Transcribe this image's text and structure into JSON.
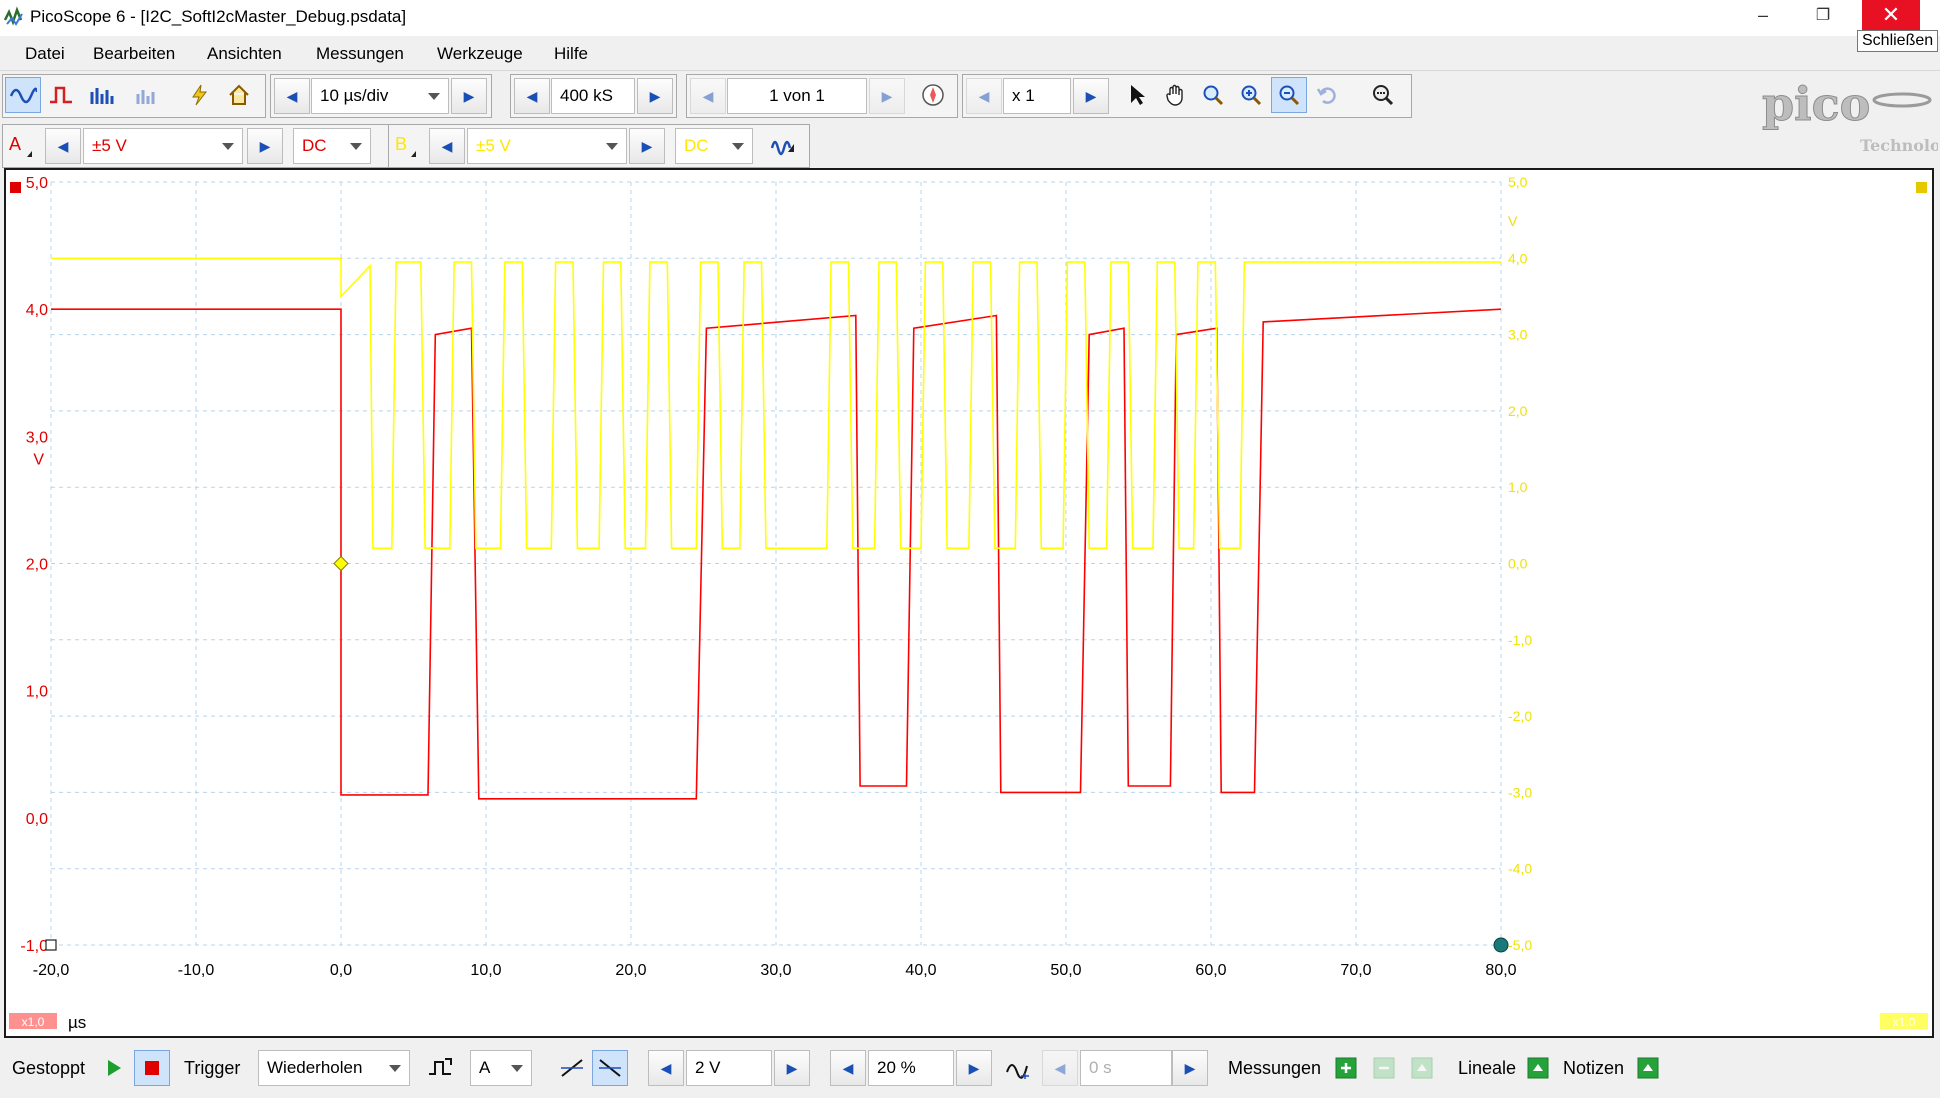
{
  "window": {
    "title": "PicoScope 6 - [I2C_SoftI2cMaster_Debug.psdata]",
    "minimize_icon": "minimize-icon",
    "restore_icon": "restore-icon",
    "close_icon": "close-icon",
    "close_tooltip": "Schließen"
  },
  "menu": [
    "Datei",
    "Bearbeiten",
    "Ansichten",
    "Messungen",
    "Werkzeuge",
    "Hilfe"
  ],
  "toolbar": {
    "timebase": "10 µs/div",
    "samples": "400 kS",
    "buffer": "1 von 1",
    "zoom": "x 1",
    "icons": [
      "scope-mode-icon",
      "persistence-mode-icon",
      "spectrum-mode-icon",
      "spectrum-alt-icon",
      "auto-setup-icon",
      "home-icon",
      "navigate-icon",
      "pointer-icon",
      "hand-icon",
      "zoom-icon",
      "zoom-in-icon",
      "zoom-out-icon",
      "undo-zoom-icon",
      "zoom-overview-icon"
    ]
  },
  "channels": {
    "a": {
      "label": "A",
      "range": "±5 V",
      "coupling": "DC",
      "color": "#ff0000"
    },
    "b": {
      "label": "B",
      "range": "±5 V",
      "coupling": "DC",
      "color": "#ffff00"
    }
  },
  "logo": {
    "brand": "pico",
    "sub": "Technology"
  },
  "chart_data": {
    "type": "line",
    "xlabel": "µs",
    "xlim": [
      -20,
      80
    ],
    "x_ticks": [
      "-20,0",
      "-10,0",
      "0,0",
      "10,0",
      "20,0",
      "30,0",
      "40,0",
      "50,0",
      "60,0",
      "70,0",
      "80,0"
    ],
    "left_axis": {
      "unit": "V",
      "ylim": [
        -1,
        5
      ],
      "ticks": [
        "5,0",
        "4,0",
        "3,0",
        "2,0",
        "1,0",
        "0,0",
        "-1,0"
      ]
    },
    "right_axis": {
      "unit": "V",
      "ylim": [
        -5,
        5
      ],
      "ticks": [
        "5,0",
        "4,0",
        "3,0",
        "2,0",
        "1,0",
        "0,0",
        "-1,0",
        "-2,0",
        "-3,0",
        "-4,0",
        "-5,0"
      ]
    },
    "scale_a": "x1,0",
    "scale_b": "x1,0",
    "series": [
      {
        "color": "#ff0000",
        "axis": "left",
        "points": [
          [
            -20,
            4.0
          ],
          [
            0.0,
            4.0
          ],
          [
            0.0,
            0.18
          ],
          [
            6.0,
            0.18
          ],
          [
            6.5,
            3.8
          ],
          [
            9.0,
            3.85
          ],
          [
            9.5,
            0.15
          ],
          [
            24.5,
            0.15
          ],
          [
            25.2,
            3.85
          ],
          [
            35.5,
            3.95
          ],
          [
            35.8,
            0.25
          ],
          [
            39.0,
            0.25
          ],
          [
            39.5,
            3.85
          ],
          [
            45.2,
            3.95
          ],
          [
            45.5,
            0.2
          ],
          [
            51.0,
            0.2
          ],
          [
            51.6,
            3.8
          ],
          [
            54.0,
            3.85
          ],
          [
            54.3,
            0.25
          ],
          [
            57.2,
            0.25
          ],
          [
            57.6,
            3.8
          ],
          [
            60.4,
            3.85
          ],
          [
            60.7,
            0.2
          ],
          [
            63.0,
            0.2
          ],
          [
            63.6,
            3.9
          ],
          [
            80,
            4.0
          ]
        ]
      },
      {
        "color": "#ffff00",
        "axis": "right",
        "points": [
          [
            -20,
            4.0
          ],
          [
            0.0,
            4.0
          ],
          [
            0.0,
            3.5
          ],
          [
            2.0,
            3.9
          ],
          [
            2.2,
            0.2
          ],
          [
            3.5,
            0.2
          ],
          [
            3.8,
            3.95
          ],
          [
            5.5,
            3.95
          ],
          [
            5.8,
            0.2
          ],
          [
            7.5,
            0.2
          ],
          [
            7.8,
            3.95
          ],
          [
            9.0,
            3.95
          ],
          [
            9.3,
            0.2
          ],
          [
            11.0,
            0.2
          ],
          [
            11.3,
            3.95
          ],
          [
            12.5,
            3.95
          ],
          [
            12.8,
            0.2
          ],
          [
            14.5,
            0.2
          ],
          [
            14.8,
            3.95
          ],
          [
            16.0,
            3.95
          ],
          [
            16.3,
            0.2
          ],
          [
            17.8,
            0.2
          ],
          [
            18.1,
            3.95
          ],
          [
            19.3,
            3.95
          ],
          [
            19.6,
            0.2
          ],
          [
            21.0,
            0.2
          ],
          [
            21.3,
            3.95
          ],
          [
            22.5,
            3.95
          ],
          [
            22.8,
            0.2
          ],
          [
            24.5,
            0.2
          ],
          [
            24.8,
            3.95
          ],
          [
            26.0,
            3.95
          ],
          [
            26.3,
            0.2
          ],
          [
            27.5,
            0.2
          ],
          [
            27.8,
            3.95
          ],
          [
            29.0,
            3.95
          ],
          [
            29.3,
            0.2
          ],
          [
            33.5,
            0.2
          ],
          [
            33.8,
            3.95
          ],
          [
            35.0,
            3.95
          ],
          [
            35.3,
            0.2
          ],
          [
            36.8,
            0.2
          ],
          [
            37.1,
            3.95
          ],
          [
            38.3,
            3.95
          ],
          [
            38.6,
            0.2
          ],
          [
            40.0,
            0.2
          ],
          [
            40.3,
            3.95
          ],
          [
            41.5,
            3.95
          ],
          [
            41.8,
            0.2
          ],
          [
            43.3,
            0.2
          ],
          [
            43.6,
            3.95
          ],
          [
            44.8,
            3.95
          ],
          [
            45.1,
            0.2
          ],
          [
            46.5,
            0.2
          ],
          [
            46.8,
            3.95
          ],
          [
            48.0,
            3.95
          ],
          [
            48.3,
            0.2
          ],
          [
            49.8,
            0.2
          ],
          [
            50.1,
            3.95
          ],
          [
            51.3,
            3.95
          ],
          [
            51.6,
            0.2
          ],
          [
            52.8,
            0.2
          ],
          [
            53.1,
            3.95
          ],
          [
            54.3,
            3.95
          ],
          [
            54.6,
            0.2
          ],
          [
            56.0,
            0.2
          ],
          [
            56.3,
            3.95
          ],
          [
            57.5,
            3.95
          ],
          [
            57.8,
            0.2
          ],
          [
            58.8,
            0.2
          ],
          [
            59.1,
            3.95
          ],
          [
            60.3,
            3.95
          ],
          [
            60.6,
            0.2
          ],
          [
            62.0,
            0.2
          ],
          [
            62.3,
            3.95
          ],
          [
            80,
            3.95
          ]
        ]
      }
    ],
    "trigger_marker": {
      "x": 0.0,
      "y": 2.0
    }
  },
  "status": {
    "state": "Gestoppt",
    "trigger_label": "Trigger",
    "trigger_mode": "Wiederholen",
    "trigger_channel": "A",
    "threshold": "2 V",
    "pretrigger": "20 %",
    "delay": "0 s",
    "measurements": "Messungen",
    "rulers": "Lineale",
    "notes": "Notizen"
  }
}
